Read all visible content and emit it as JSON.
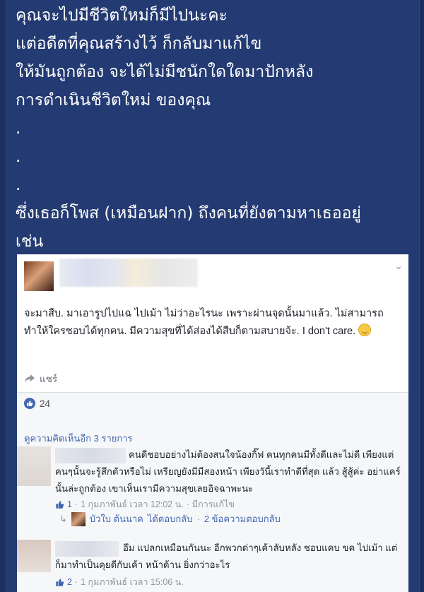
{
  "post": {
    "lines": [
      "คุณจะไปมีชีวิตใหม่ก็มีไปนะคะ",
      "แต่อดีตที่คุณสร้างไว้ ก็กลับมาแก้ไข",
      "ให้มันถูกต้อง จะได้ไม่มีชนักใดใดมาปักหลัง",
      "การดำเนินชีวิตใหม่ ของคุณ",
      ".",
      ".",
      ".",
      "ซึ่งเธอก็โพส (เหมือนฝาก) ถึงคนที่ยังตามหาเธออยู่",
      "เช่น"
    ]
  },
  "card": {
    "status": "จะมาสืบ. มาเอารูปไปแฉ ไปเม้า ไม่ว่าอะไรนะ เพราะผ่านจุดนั้นมาแล้ว. ไม่สามารถทำให้ใครชอบได้ทุกคน. มีความสุขที่ได้ส่องได้สืบก็ตามสบายจ้ะ. I don't care.",
    "share_label": "แชร์",
    "like_count": "24",
    "view_more": "ดูความคิดเห็นอีก 3 รายการ",
    "comments": [
      {
        "text": "คนดีชอบอย่างไม่ต้องสนใจน้องกิ๊ฟ คนทุกคนมีทั้งดีและไม่ดี เพียงแต่คนๆนั้นจะรู้สึกตัวหรือไม่ เหรียญยังมีมีสองหน้า เพียงวันี้เราทำดีที่สุด แล้ว สู้สู้ค่ะ อย่าแคร์นั้นล่ะถูกต้อง เขาเห็นเรามีความสุขเลยอิจฉาพะนะ",
        "likes": "1",
        "date": "1 กุมภาพันธ์ เวลา 12:02 น.",
        "edited": "มีการแก้ไข"
      },
      {
        "text": "อึม แปลกเหมือนกันนะ อีกพวกด่าๆเค้าลับหลัง ชอบแคบ ขค ไปเม้า แต่ก็มาทำเป็นคุยดีกับเค้า หน้าด้าน ยิ่งกว่าอะไร",
        "likes": "2",
        "date": "1 กุมภาพันธ์ เวลา 15:06 น."
      }
    ],
    "reply": {
      "name": "บัวใบ ต้นนาค",
      "action": "ได้ตอบกลับ",
      "count": "2 ข้อความตอบกลับ"
    }
  },
  "colors": {
    "background": "#233a72",
    "link": "#4267b2"
  }
}
